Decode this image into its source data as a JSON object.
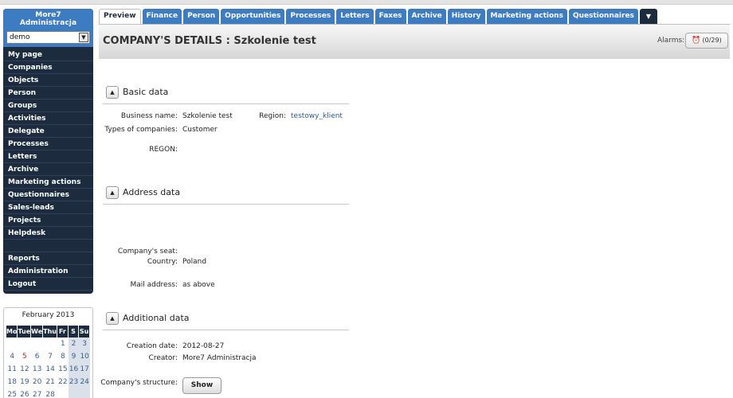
{
  "sidebar": {
    "title": "More7 Administracja",
    "select_value": "demo",
    "menu": [
      "My page",
      "Companies",
      "Objects",
      "Person",
      "Groups",
      "Activities",
      "Delegate",
      "Processes",
      "Letters",
      "Archive",
      "Marketing actions",
      "Questionnaires",
      "Sales-leads",
      "Projects",
      "Helpdesk"
    ],
    "menu_bottom": [
      "Reports",
      "Administration",
      "Logout"
    ]
  },
  "calendar": {
    "title": "February 2013",
    "weekdays": [
      "Mo",
      "Tue",
      "We",
      "Thu",
      "Fr",
      "S",
      "Su"
    ],
    "rows": [
      [
        "",
        "",
        "",
        "",
        "1",
        "2",
        "3"
      ],
      [
        "4",
        "5",
        "6",
        "7",
        "8",
        "9",
        "10"
      ],
      [
        "11",
        "12",
        "13",
        "14",
        "15",
        "16",
        "17"
      ],
      [
        "18",
        "19",
        "20",
        "21",
        "22",
        "23",
        "24"
      ],
      [
        "25",
        "26",
        "27",
        "28",
        "",
        "",
        ""
      ]
    ]
  },
  "tabs": [
    "Preview",
    "Finance",
    "Person",
    "Opportunities",
    "Processes",
    "Letters",
    "Faxes",
    "Archive",
    "History",
    "Marketing actions",
    "Questionnaires"
  ],
  "tabs_more": "▼",
  "header": {
    "title": "COMPANY'S DETAILS : Szkolenie test",
    "alarms_label": "Alarms:",
    "alarms_count": "(0/29)"
  },
  "basic": {
    "title": "Basic data",
    "business_name_label": "Business name:",
    "business_name": "Szkolenie test",
    "region_label": "Region:",
    "region": "testowy_klient",
    "types_label": "Types of companies:",
    "types": "Customer",
    "regon_label": "REGON:"
  },
  "address": {
    "title": "Address data",
    "seat_label": "Company's seat:",
    "country_label": "Country:",
    "country": "Poland",
    "mail_label": "Mail address:",
    "mail": "as above"
  },
  "additional": {
    "title": "Additional data",
    "creation_label": "Creation date:",
    "creation": "2012-08-27",
    "creator_label": "Creator:",
    "creator": "More7 Administracja",
    "structure_label": "Company's structure:",
    "show_label": "Show"
  },
  "colors": {
    "accent": "#3d7cc0",
    "sidebar": "#1d2b3e"
  }
}
